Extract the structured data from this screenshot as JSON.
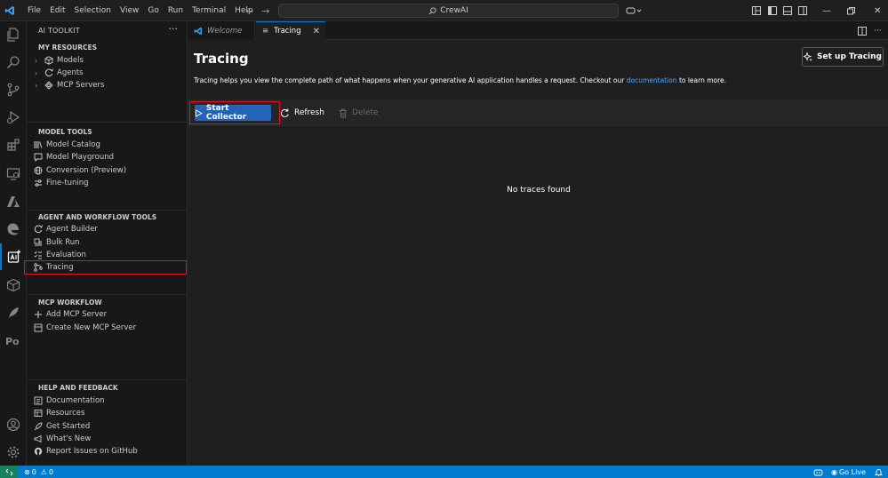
{
  "titlebar": {
    "menu": [
      "File",
      "Edit",
      "Selection",
      "View",
      "Go",
      "Run",
      "Terminal",
      "Help"
    ],
    "search_text": "CrewAI"
  },
  "sidebar": {
    "title": "AI TOOLKIT",
    "sections": {
      "my_resources": {
        "header": "MY RESOURCES",
        "items": [
          "Models",
          "Agents",
          "MCP Servers"
        ]
      },
      "model_tools": {
        "header": "MODEL TOOLS",
        "items": [
          "Model Catalog",
          "Model Playground",
          "Conversion (Preview)",
          "Fine-tuning"
        ]
      },
      "agent_tools": {
        "header": "AGENT AND WORKFLOW TOOLS",
        "items": [
          "Agent Builder",
          "Bulk Run",
          "Evaluation",
          "Tracing"
        ]
      },
      "mcp_workflow": {
        "header": "MCP WORKFLOW",
        "items": [
          "Add MCP Server",
          "Create New MCP Server"
        ]
      },
      "help": {
        "header": "HELP AND FEEDBACK",
        "items": [
          "Documentation",
          "Resources",
          "Get Started",
          "What's New",
          "Report Issues on GitHub"
        ]
      }
    }
  },
  "tabs": [
    {
      "label": "Welcome"
    },
    {
      "label": "Tracing"
    }
  ],
  "main": {
    "title": "Tracing",
    "setup_button": "Set up Tracing",
    "description_before": "Tracing helps you view the complete path of what happens when your generative AI application handles a request. Checkout our",
    "description_link": "documentation",
    "description_after": "to learn more.",
    "start_button": "Start Collector",
    "refresh_button": "Refresh",
    "delete_button": "Delete",
    "empty_message": "No traces found"
  },
  "statusbar": {
    "errors": "0",
    "warnings": "0",
    "go_live": "Go Live"
  },
  "colors": {
    "accent": "#007acc",
    "primary_button": "#2563b7",
    "highlight": "#e81123",
    "link": "#4daafc"
  }
}
